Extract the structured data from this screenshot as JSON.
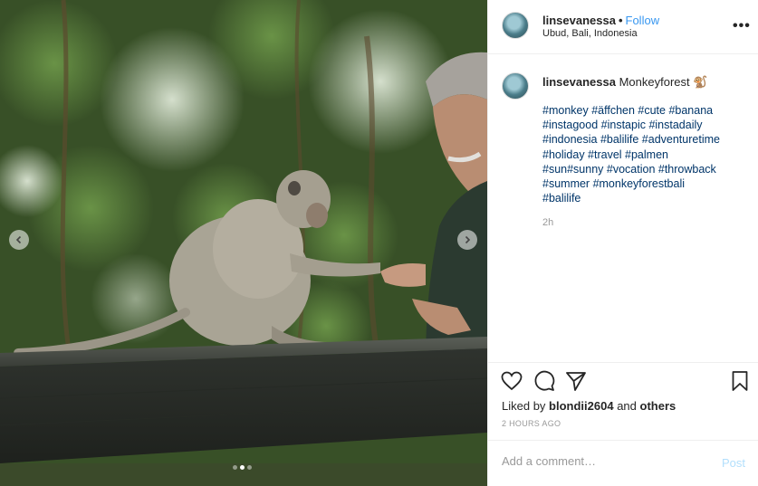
{
  "post": {
    "username": "linsevanessa",
    "separator": "•",
    "follow_label": "Follow",
    "location": "Ubud, Bali, Indonesia",
    "more_icon": "more-horizontal-icon",
    "caption": "Monkeyforest 🐒",
    "hashtags": [
      "#monkey #äffchen #cute #banana",
      "#instagood #instapic #instadaily",
      "#indonesia #balilife #adventuretime",
      "#holiday #travel #palmen",
      "#sun#sunny #vocation #throwback",
      "#summer #monkeyforestbali",
      "#balilife"
    ],
    "caption_time": "2h",
    "liked_by_prefix": "Liked by",
    "liked_by_user": "blondii2604",
    "liked_by_and": "and",
    "liked_by_others": "others",
    "posted_ago": "2 HOURS AGO",
    "comment_placeholder": "Add a comment…",
    "post_label": "Post"
  },
  "media": {
    "carousel_total": 3,
    "carousel_active": 2,
    "prev_icon": "chevron-left-icon",
    "next_icon": "chevron-right-icon"
  },
  "colors": {
    "link": "#3897f0",
    "hashtag": "#003569",
    "muted": "#999999",
    "post_disabled": "#b2dffc"
  }
}
